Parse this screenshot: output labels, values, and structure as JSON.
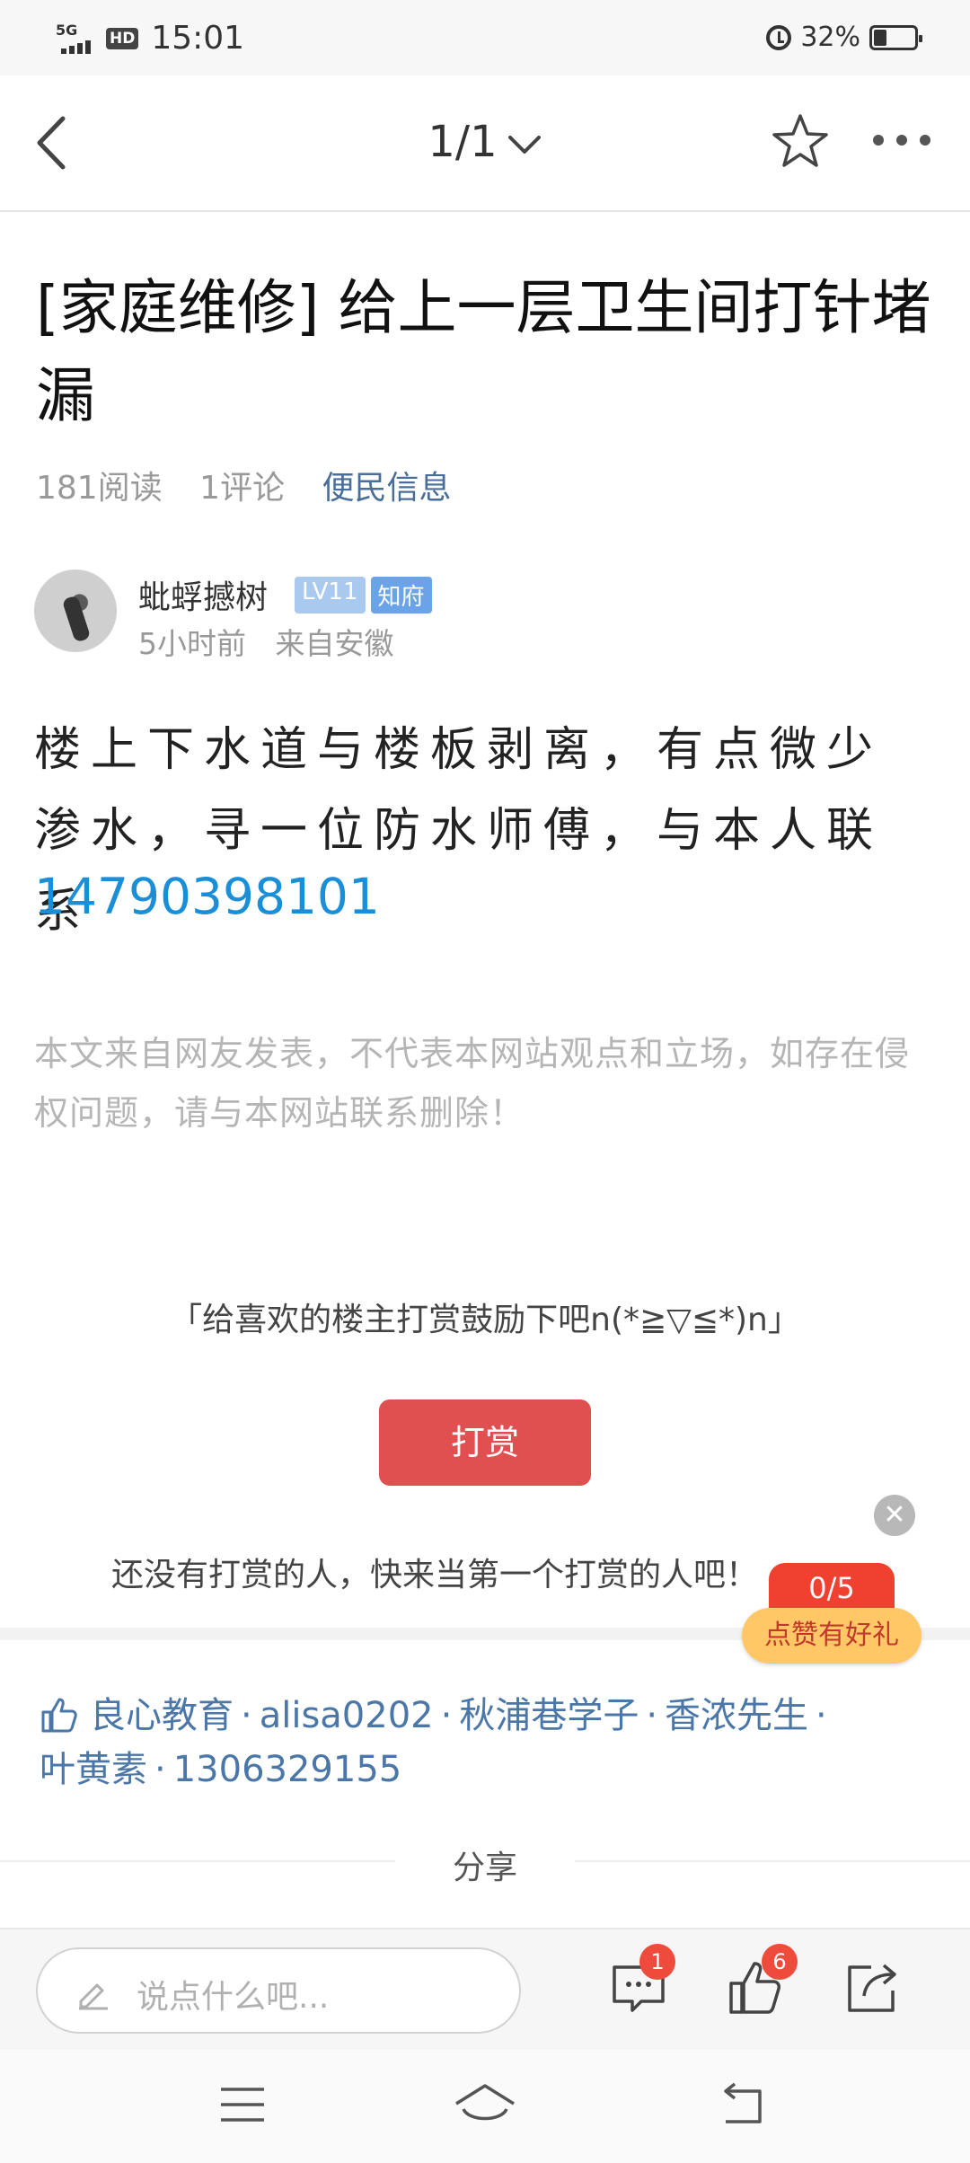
{
  "status_bar": {
    "network": "5G",
    "hd": "HD",
    "time": "15:01",
    "battery": "32%"
  },
  "nav": {
    "page_indicator": "1/1"
  },
  "article": {
    "title": "[家庭维修] 给上一层卫生间打针堵漏",
    "reads": "181阅读",
    "comments": "1评论",
    "category": "便民信息",
    "author": {
      "name": "蚍蜉撼树",
      "level": "LV11",
      "role": "知府",
      "time": "5小时前",
      "location": "来自安徽"
    },
    "body": "楼上下水道与楼板剥离，有点微少渗水，寻一位防水师傅，与本人联系",
    "phone": "14790398101",
    "disclaimer": "本文来自网友发表，不代表本网站观点和立场，如存在侵权问题，请与本网站联系删除！"
  },
  "reward": {
    "message": "「给喜欢的楼主打赏鼓励下吧n(*≧▽≦*)n」",
    "button": "打赏",
    "empty": "还没有打赏的人，快来当第一个打赏的人吧！"
  },
  "like_float": {
    "count": "0/5",
    "promo": "点赞有好礼"
  },
  "likers": {
    "names": [
      "良心教育",
      "alisa0202",
      "秋浦巷学子",
      "香浓先生",
      "叶黄素",
      "1306329155"
    ]
  },
  "share": {
    "label": "分享"
  },
  "action_bar": {
    "comment_placeholder": "说点什么吧...",
    "comment_badge": "1",
    "like_badge": "6"
  }
}
